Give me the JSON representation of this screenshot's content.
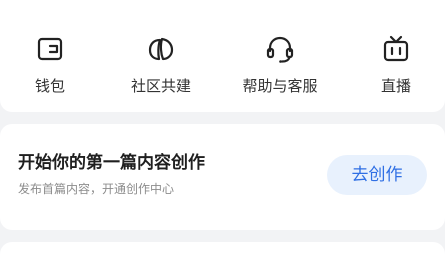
{
  "prev_row": {
    "labels": [
      "",
      "",
      "",
      ""
    ]
  },
  "grid": {
    "items": [
      {
        "label": "钱包",
        "icon": "wallet-icon"
      },
      {
        "label": "社区共建",
        "icon": "community-icon"
      },
      {
        "label": "帮助与客服",
        "icon": "headset-icon"
      },
      {
        "label": "直播",
        "icon": "tv-icon"
      }
    ]
  },
  "creator": {
    "title": "开始你的第一篇内容创作",
    "subtitle": "发布首篇内容，开通创作中心",
    "button_label": "去创作"
  },
  "colors": {
    "accent": "#2f6fe4",
    "button_bg": "#e8f1fd",
    "page_bg": "#f2f3f5"
  }
}
